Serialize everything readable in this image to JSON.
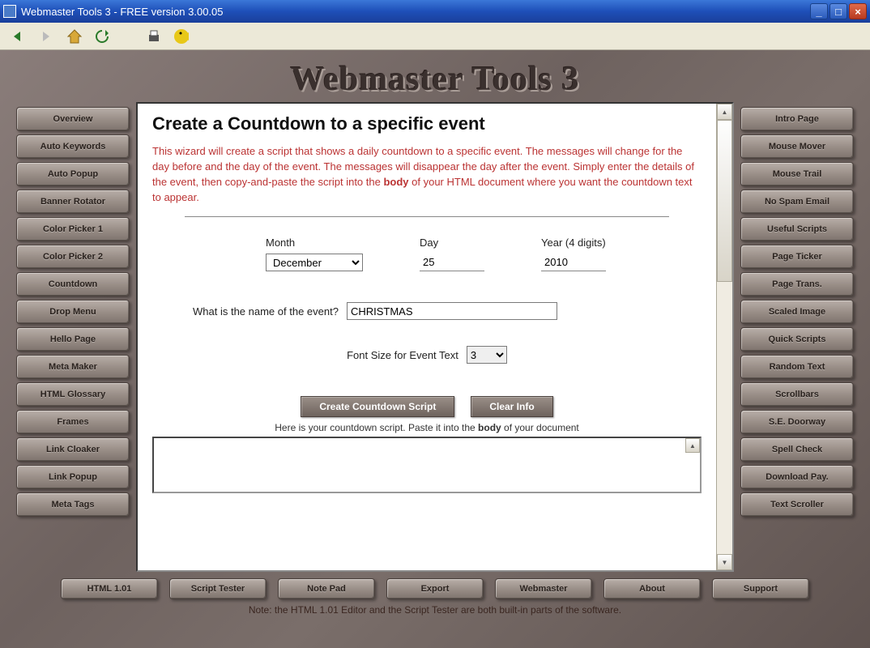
{
  "window": {
    "title": "Webmaster Tools 3 - FREE version 3.00.05"
  },
  "app_title": "Webmaster Tools 3",
  "left_nav": [
    "Overview",
    "Auto Keywords",
    "Auto Popup",
    "Banner Rotator",
    "Color Picker 1",
    "Color Picker 2",
    "Countdown",
    "Drop Menu",
    "Hello Page",
    "Meta Maker",
    "HTML Glossary",
    "Frames",
    "Link Cloaker",
    "Link Popup",
    "Meta Tags"
  ],
  "right_nav": [
    "Intro Page",
    "Mouse Mover",
    "Mouse Trail",
    "No Spam Email",
    "Useful Scripts",
    "Page Ticker",
    "Page Trans.",
    "Scaled Image",
    "Quick Scripts",
    "Random Text",
    "Scrollbars",
    "S.E. Doorway",
    "Spell Check",
    "Download Pay.",
    "Text Scroller"
  ],
  "pane": {
    "title": "Create a Countdown to a specific event",
    "description_prefix": "This wizard will create a script that shows a daily countdown to a specific event. The messages will change for the day before and the day of the event. The messages will disappear the day after the event. Simply enter the details of the event, then copy-and-paste the script into the ",
    "description_bold": "body",
    "description_suffix": " of your HTML document where you want the countdown text to appear.",
    "month_label": "Month",
    "month_value": "December",
    "day_label": "Day",
    "day_value": "25",
    "year_label": "Year (4 digits)",
    "year_value": "2010",
    "event_name_label": "What is the name of the event?",
    "event_name_value": "CHRISTMAS",
    "font_size_label": "Font Size for Event Text",
    "font_size_value": "3",
    "create_btn": "Create Countdown Script",
    "clear_btn": "Clear Info",
    "output_label_prefix": "Here is your countdown script. Paste it into the ",
    "output_label_bold": "body",
    "output_label_suffix": " of your document"
  },
  "bottom_nav": [
    "HTML 1.01",
    "Script Tester",
    "Note Pad",
    "Export",
    "Webmaster",
    "About",
    "Support"
  ],
  "footer": "Note: the HTML 1.01 Editor and the Script Tester are both built-in parts of the software."
}
